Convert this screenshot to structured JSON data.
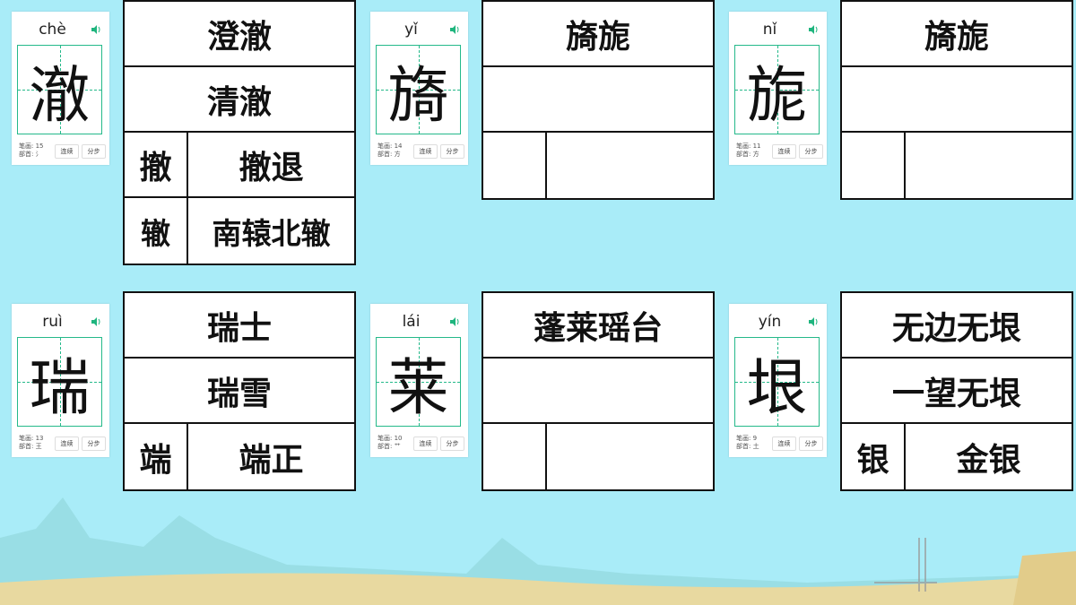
{
  "colors": {
    "sky": "#a9ecf8",
    "grid": "#25b98a",
    "speaker": "#1fb57e"
  },
  "cards": [
    {
      "pinyin": "chè",
      "char": "澈",
      "strokes_label": "笔画: 15",
      "radical_label": "部首: 氵",
      "btn1": "连续",
      "btn2": "分步",
      "rows": [
        {
          "text": "澄澈"
        },
        {
          "text": "清澈"
        },
        {
          "c1": "撤",
          "c2": "撤退"
        },
        {
          "c1": "辙",
          "c2": "南辕北辙"
        }
      ]
    },
    {
      "pinyin": "yǐ",
      "char": "旖",
      "strokes_label": "笔画: 14",
      "radical_label": "部首: 方",
      "btn1": "连续",
      "btn2": "分步",
      "rows": [
        {
          "text": "旖旎"
        },
        {
          "text": ""
        },
        {
          "c1": "",
          "c2": ""
        }
      ]
    },
    {
      "pinyin": "nǐ",
      "char": "旎",
      "strokes_label": "笔画: 11",
      "radical_label": "部首: 方",
      "btn1": "连续",
      "btn2": "分步",
      "rows": [
        {
          "text": "旖旎"
        },
        {
          "text": ""
        },
        {
          "c1": "",
          "c2": ""
        }
      ]
    },
    {
      "pinyin": "ruì",
      "char": "瑞",
      "strokes_label": "笔画: 13",
      "radical_label": "部首: 王",
      "btn1": "连续",
      "btn2": "分步",
      "rows": [
        {
          "text": "瑞士"
        },
        {
          "text": "瑞雪"
        },
        {
          "c1": "端",
          "c2": "端正"
        }
      ]
    },
    {
      "pinyin": "lái",
      "char": "莱",
      "strokes_label": "笔画: 10",
      "radical_label": "部首: 艹",
      "btn1": "连续",
      "btn2": "分步",
      "rows": [
        {
          "text": "蓬莱瑶台"
        },
        {
          "text": ""
        },
        {
          "c1": "",
          "c2": ""
        }
      ]
    },
    {
      "pinyin": "yín",
      "char": "垠",
      "strokes_label": "笔画: 9",
      "radical_label": "部首: 土",
      "btn1": "连续",
      "btn2": "分步",
      "rows": [
        {
          "text": "无边无垠"
        },
        {
          "text": "一望无垠"
        },
        {
          "c1": "银",
          "c2": "金银"
        }
      ]
    }
  ]
}
